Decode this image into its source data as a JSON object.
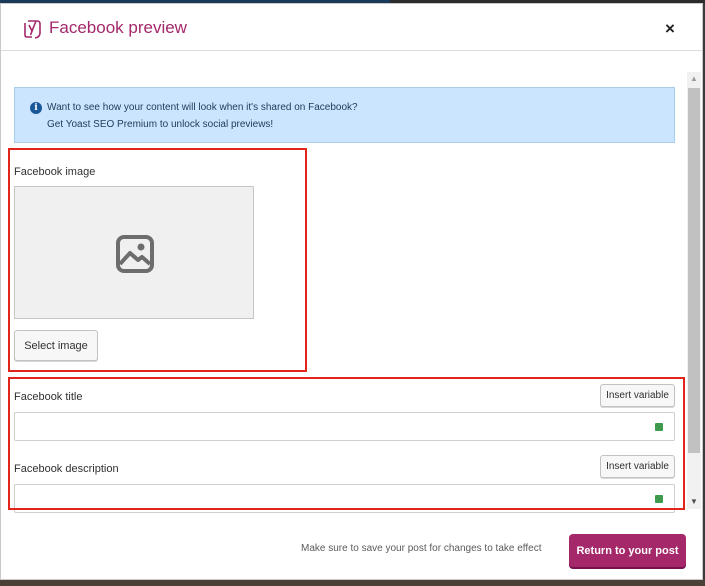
{
  "modal": {
    "title": "Facebook preview",
    "close_glyph": "×"
  },
  "notice": {
    "line1": "Want to see how your content will look when it's shared on Facebook?",
    "line2": "Get Yoast SEO Premium to unlock social previews!",
    "icon": "info-icon"
  },
  "image_section": {
    "label": "Facebook image",
    "select_button": "Select image",
    "placeholder_icon": "image-icon"
  },
  "title_section": {
    "label": "Facebook title",
    "insert_button": "Insert variable",
    "value": ""
  },
  "description_section": {
    "label": "Facebook description",
    "insert_button": "Insert variable",
    "value": ""
  },
  "footer": {
    "note": "Make sure to save your post for changes to take effect",
    "return_button": "Return to your post"
  },
  "colors": {
    "brand": "#a4286a",
    "notice_bg": "#cce5ff",
    "highlight": "#e1251b",
    "status_dot": "#3f9a4c"
  }
}
